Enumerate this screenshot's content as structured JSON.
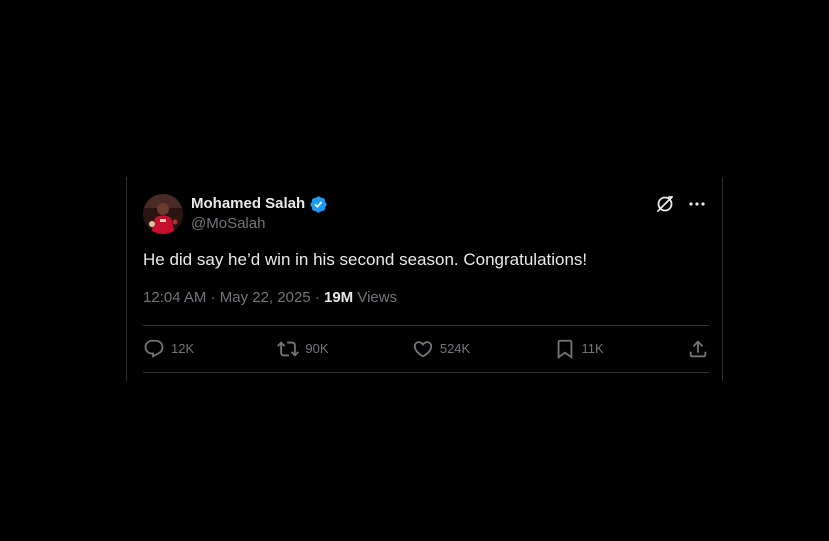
{
  "tweet": {
    "author": {
      "display_name": "Mohamed Salah",
      "handle": "@MoSalah",
      "verified": true
    },
    "text": "He did say he’d win in his second season. Congratulations!",
    "time": "12:04 AM",
    "separator": "·",
    "date": "May 22, 2025",
    "views_count": "19M",
    "views_label": "Views",
    "actions": {
      "replies": "12K",
      "reposts": "90K",
      "likes": "524K",
      "bookmarks": "11K"
    }
  },
  "colors": {
    "background": "#000000",
    "text_primary": "#e7e9ea",
    "text_secondary": "#71767b",
    "border": "#2f3336",
    "verified": "#1d9bf0"
  },
  "icons": {
    "verified": "verified-badge-icon",
    "grok": "grok-icon",
    "more": "more-icon",
    "reply": "reply-icon",
    "repost": "repost-icon",
    "like": "heart-icon",
    "bookmark": "bookmark-icon",
    "share": "share-icon"
  }
}
